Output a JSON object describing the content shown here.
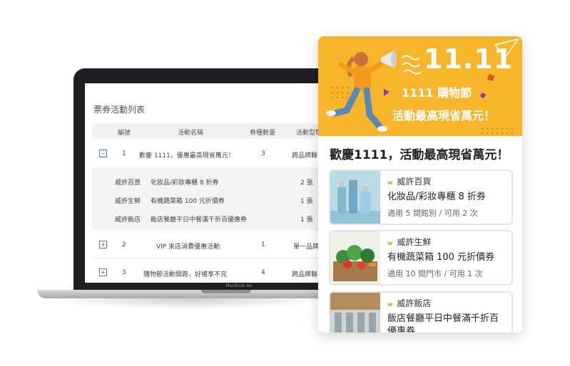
{
  "laptop": {
    "brand": "MacBook Air",
    "page_title": "票券活動列表",
    "columns": [
      "編號",
      "活動名稱",
      "券種數量",
      "活動型態"
    ],
    "rows": [
      {
        "toggle": "−",
        "no": "1",
        "name": "歡慶 1111，優惠最高現省萬元！",
        "count": "3",
        "type": "跨品牌聯"
      },
      {
        "toggle": "+",
        "no": "2",
        "name": "VIP 來店消費優惠活動",
        "count": "1",
        "type": "單一品牌"
      },
      {
        "toggle": "+",
        "no": "3",
        "name": "購物節活動開跑，好禮享不完",
        "count": "4",
        "type": "跨品牌聯"
      }
    ],
    "sub_rows": [
      {
        "store": "威許百貨",
        "item": "化妝品/彩妝專櫃 8 折券",
        "qty": "2 張"
      },
      {
        "store": "威許生鮮",
        "item": "有機蔬菜箱 100 元折價券",
        "qty": "1 張"
      },
      {
        "store": "威許飯店",
        "item": "飯店餐廳平日中餐滿千折百優惠券",
        "qty": "1 張"
      }
    ]
  },
  "card": {
    "banner_big": "11.11",
    "banner_line1": "1111 購物節",
    "banner_line2": "活動最高現省萬元！",
    "heading": "歡慶1111，活動最高現省萬元！",
    "coupons": [
      {
        "logo": "w",
        "store": "威許百貨",
        "name": "化妝品/彩妝專櫃 8 折券",
        "usage": "適用 5 間館別 / 可用 2 次"
      },
      {
        "logo": "w",
        "store": "威許生鮮",
        "name": "有機蔬菜箱 100 元折價券",
        "usage": "適用 10 間門市 / 可用 1 次"
      },
      {
        "logo": "w",
        "store": "威許飯店",
        "name": "飯店餐廳平日中餐滿千折百優惠券",
        "usage": ""
      }
    ]
  },
  "colors": {
    "banner": "#f7b52b",
    "accent": "#2c8c99"
  }
}
